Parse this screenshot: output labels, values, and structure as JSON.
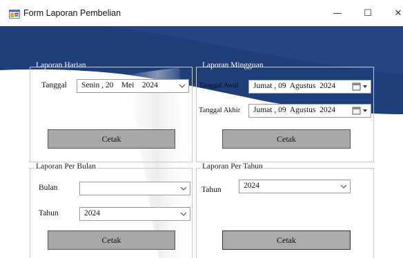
{
  "window": {
    "title": "Form Laporan Pembelian"
  },
  "titlebar_buttons": {
    "minimize": "—",
    "maximize": "☐",
    "close": "✕"
  },
  "colors": {
    "header_blue": "#1f3f7a",
    "header_blue_dark": "#183468",
    "button_gray": "#a8a8a8"
  },
  "harian": {
    "title": "Laporan Harian",
    "tanggal_label": "Tanggal",
    "tanggal_value": "Senin , 20    Mei    2024",
    "cetak_label": "Cetak"
  },
  "mingguan": {
    "title": "Laporan Mingguan",
    "awal_label": "Tanggal Awal",
    "awal_value": "Jumat , 09  Agustus  2024",
    "akhir_label": "Tanggal Akhir",
    "akhir_value": "Jumat , 09  Agustus  2024",
    "cetak_label": "Cetak"
  },
  "bulan": {
    "title": "Laporan Per Bulan",
    "bulan_label": "Bulan",
    "bulan_value": "",
    "tahun_label": "Tahun",
    "tahun_value": "2024",
    "cetak_label": "Cetak"
  },
  "tahun": {
    "title": "Laporan Per Tahun",
    "tahun_label": "Tahun",
    "tahun_value": "2024",
    "cetak_label": "Cetak"
  }
}
